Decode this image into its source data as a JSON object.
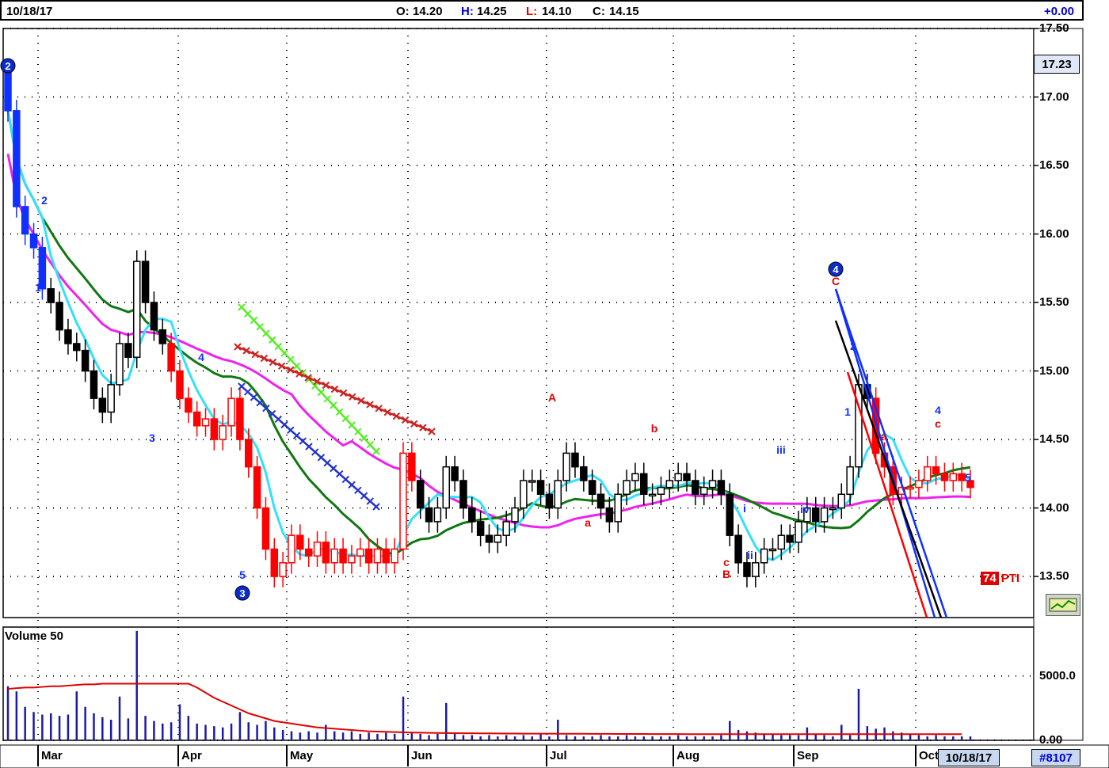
{
  "header": {
    "date": "10/18/17",
    "open_label": "O:",
    "open": "14.20",
    "high_label": "H:",
    "high": "14.25",
    "low_label": "L:",
    "low": "14.10",
    "close_label": "C:",
    "close": "14.15",
    "change": "+0.00"
  },
  "last_price": "17.23",
  "volume_label": "Volume 50",
  "pti": {
    "value": "74",
    "label": "PTI"
  },
  "footer": {
    "date": "10/18/17",
    "symbol_id": "#8107"
  },
  "colors": {
    "up_red": "#ff0000",
    "down_black": "#000000",
    "ma_cyan": "#33e0ff",
    "ma_green": "#117711",
    "ma_magenta": "#ee22ee",
    "wave_blue": "#0a2ccc"
  },
  "chart_data": {
    "type": "line",
    "ylim": [
      13.2,
      17.5
    ],
    "volume_ylim": [
      0,
      8800
    ],
    "yticks": [
      "17.50",
      "17.00",
      "16.50",
      "16.00",
      "15.50",
      "15.00",
      "14.50",
      "14.00",
      "13.50"
    ],
    "volume_yticks": [
      "5000.0",
      "0.00"
    ],
    "months": [
      "Mar",
      "Apr",
      "May",
      "Jun",
      "Jul",
      "Aug",
      "Sep",
      "Oct"
    ],
    "close_series": [
      16.9,
      16.2,
      16.0,
      15.9,
      15.6,
      15.5,
      15.3,
      15.2,
      15.15,
      15.0,
      14.8,
      14.7,
      14.9,
      15.2,
      15.1,
      15.8,
      15.5,
      15.3,
      15.2,
      15.0,
      14.8,
      14.7,
      14.6,
      14.65,
      14.5,
      14.6,
      14.8,
      14.5,
      14.3,
      14.0,
      13.7,
      13.5,
      13.6,
      13.8,
      13.7,
      13.65,
      13.75,
      13.6,
      13.7,
      13.6,
      13.65,
      13.7,
      13.6,
      13.7,
      13.6,
      13.7,
      14.4,
      14.2,
      14.0,
      13.9,
      14.0,
      14.3,
      14.2,
      14.0,
      13.9,
      13.8,
      13.75,
      13.8,
      13.9,
      14.0,
      14.2,
      14.2,
      14.1,
      14.0,
      14.2,
      14.4,
      14.3,
      14.2,
      14.1,
      14.0,
      13.9,
      14.1,
      14.2,
      14.25,
      14.1,
      14.1,
      14.15,
      14.2,
      14.25,
      14.2,
      14.1,
      14.15,
      14.2,
      14.1,
      13.8,
      13.6,
      13.5,
      13.6,
      13.7,
      13.7,
      13.8,
      13.75,
      13.9,
      14.0,
      13.9,
      14.0,
      14.0,
      14.1,
      14.3,
      14.9,
      14.8,
      14.4,
      14.3,
      14.1,
      14.15,
      14.15,
      14.2,
      14.3,
      14.25,
      14.2,
      14.25,
      14.2,
      14.15
    ],
    "volume_series": [
      4200,
      3800,
      2600,
      2200,
      2000,
      2100,
      1900,
      2000,
      3800,
      2600,
      2100,
      1800,
      1600,
      3400,
      1700,
      8500,
      1900,
      1500,
      1300,
      1400,
      2800,
      1900,
      1300,
      1200,
      1100,
      1000,
      1300,
      2200,
      1400,
      1200,
      1500,
      1000,
      800,
      700,
      600,
      700,
      600,
      1200,
      700,
      600,
      700,
      500,
      600,
      500,
      600,
      500,
      3400,
      600,
      500,
      400,
      500,
      2900,
      500,
      400,
      400,
      300,
      400,
      300,
      400,
      300,
      400,
      300,
      500,
      300,
      1600,
      400,
      300,
      300,
      300,
      400,
      300,
      300,
      400,
      300,
      300,
      300,
      300,
      300,
      400,
      300,
      300,
      300,
      300,
      400,
      1500,
      800,
      700,
      600,
      500,
      500,
      400,
      400,
      400,
      1000,
      500,
      400,
      300,
      1200,
      400,
      4000,
      1100,
      900,
      1000,
      700,
      600,
      500,
      400,
      300,
      400,
      300,
      300,
      300,
      300
    ],
    "volume_ma": [
      4000,
      4050,
      4100,
      4100,
      4150,
      4200,
      4200,
      4250,
      4300,
      4350,
      4350,
      4400,
      4400,
      4400,
      4400,
      4400,
      4400,
      4400,
      4400,
      4400,
      4400,
      4400,
      4100,
      3700,
      3300,
      3000,
      2700,
      2400,
      2100,
      1900,
      1700,
      1500,
      1400,
      1300,
      1200,
      1100,
      1000,
      950,
      900,
      850,
      800,
      750,
      700,
      680,
      660,
      640,
      620,
      600,
      590,
      580,
      570,
      560,
      555,
      550,
      545,
      540,
      535,
      530,
      525,
      520,
      518,
      516,
      514,
      512,
      510,
      508,
      506,
      504,
      502,
      500,
      498,
      496,
      494,
      492,
      490,
      488,
      486,
      484,
      482,
      480,
      480,
      480,
      480,
      480,
      480,
      480,
      480,
      480,
      480,
      480,
      480,
      480,
      480,
      480,
      480,
      480,
      480,
      480,
      480,
      480,
      480,
      480,
      480,
      480,
      480,
      480,
      480,
      480,
      480,
      480,
      480,
      480
    ]
  },
  "wave_labels": [
    {
      "text": "2",
      "kind": "circle"
    },
    {
      "text": "2",
      "kind": "blue"
    },
    {
      "text": "1",
      "kind": "blue"
    },
    {
      "text": "3",
      "kind": "blue"
    },
    {
      "text": "4",
      "kind": "blue"
    },
    {
      "text": "5",
      "kind": "blue"
    },
    {
      "text": "3",
      "kind": "circle"
    },
    {
      "text": "A",
      "kind": "red"
    },
    {
      "text": "a",
      "kind": "red"
    },
    {
      "text": "b",
      "kind": "red"
    },
    {
      "text": "c",
      "kind": "red"
    },
    {
      "text": "B",
      "kind": "red"
    },
    {
      "text": "i",
      "kind": "blue"
    },
    {
      "text": "ii",
      "kind": "blue"
    },
    {
      "text": "iii",
      "kind": "blue"
    },
    {
      "text": "iv",
      "kind": "blue"
    },
    {
      "text": "4",
      "kind": "circle"
    },
    {
      "text": "C",
      "kind": "red"
    },
    {
      "text": "1",
      "kind": "blue"
    },
    {
      "text": "2",
      "kind": "blue"
    },
    {
      "text": "a",
      "kind": "red"
    },
    {
      "text": "4",
      "kind": "blue"
    },
    {
      "text": "c",
      "kind": "red"
    },
    {
      "text": "5",
      "kind": "blue"
    }
  ]
}
